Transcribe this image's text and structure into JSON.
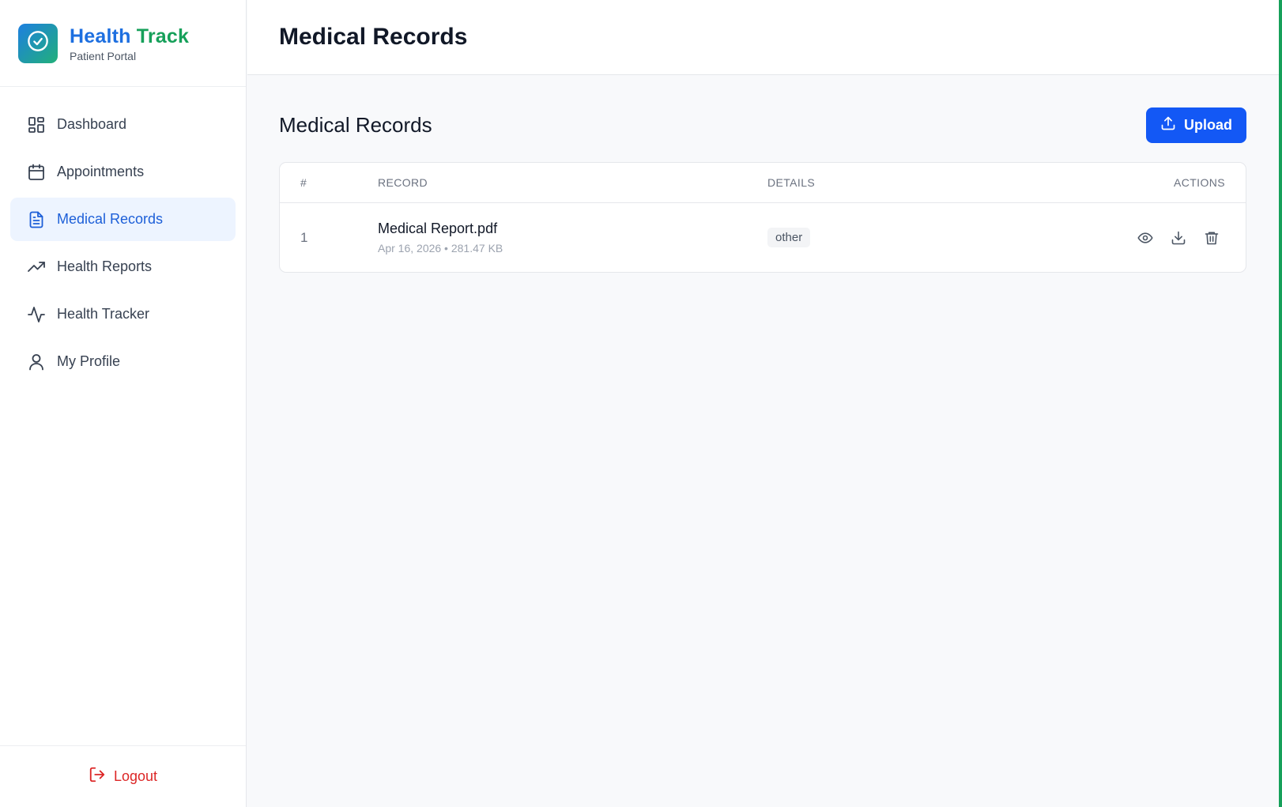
{
  "brand": {
    "title_part1": "Health",
    "title_part2": "Track",
    "subtitle": "Patient Portal",
    "logo_icon": "check-circle-icon"
  },
  "sidebar": {
    "items": [
      {
        "label": "Dashboard",
        "icon": "dashboard-grid-icon",
        "active": false
      },
      {
        "label": "Appointments",
        "icon": "calendar-icon",
        "active": false
      },
      {
        "label": "Medical Records",
        "icon": "document-icon",
        "active": true
      },
      {
        "label": "Health Reports",
        "icon": "trending-up-icon",
        "active": false
      },
      {
        "label": "Health Tracker",
        "icon": "activity-pulse-icon",
        "active": false
      },
      {
        "label": "My Profile",
        "icon": "user-icon",
        "active": false
      }
    ],
    "logout_label": "Logout"
  },
  "header": {
    "title": "Medical Records"
  },
  "main": {
    "section_title": "Medical Records",
    "upload_label": "Upload",
    "table": {
      "columns": [
        "#",
        "RECORD",
        "DETAILS",
        "ACTIONS"
      ],
      "rows": [
        {
          "index": "1",
          "name": "Medical Report.pdf",
          "meta": "Apr 16, 2026 • 281.47 KB",
          "category": "other",
          "actions": [
            "eye-icon",
            "download-icon",
            "trash-icon"
          ]
        }
      ]
    }
  },
  "colors": {
    "primary": "#1358f5",
    "brand_blue": "#1d6fe0",
    "brand_green": "#16a05a",
    "active_bg": "#edf4ff",
    "danger": "#dc2626"
  }
}
